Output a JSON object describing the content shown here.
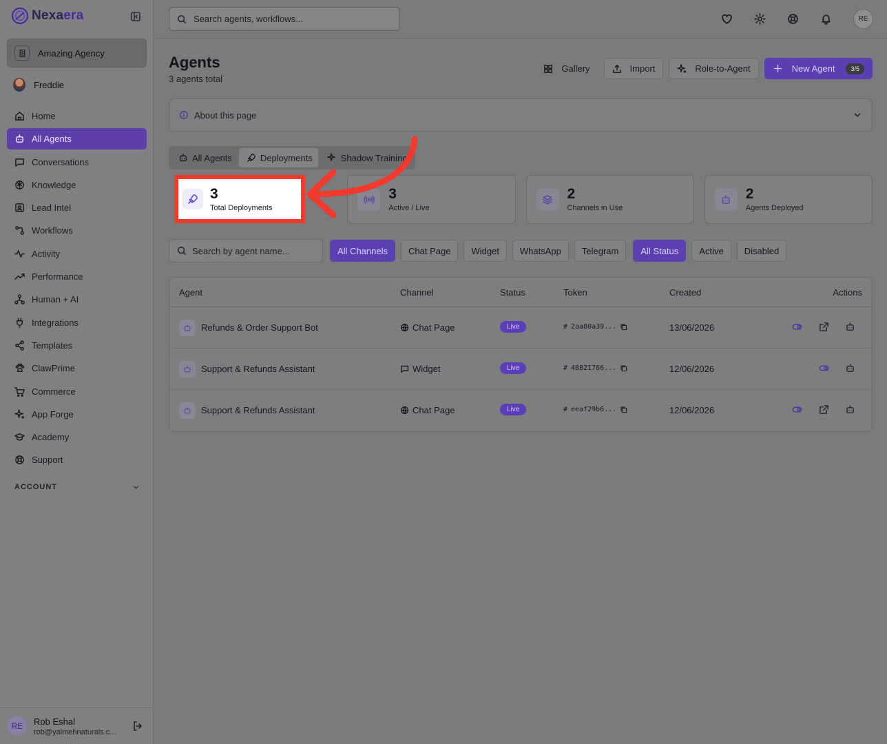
{
  "brand": {
    "name_a": "Nexa",
    "name_b": "era"
  },
  "sidebar": {
    "agency": "Amazing Agency",
    "user": "Freddie",
    "nav": [
      {
        "label": "Home",
        "icon": "home-icon"
      },
      {
        "label": "All Agents",
        "icon": "bot-icon",
        "active": true
      },
      {
        "label": "Conversations",
        "icon": "message-icon"
      },
      {
        "label": "Knowledge",
        "icon": "brain-icon"
      },
      {
        "label": "Lead Intel",
        "icon": "contact-icon"
      },
      {
        "label": "Workflows",
        "icon": "workflow-icon"
      },
      {
        "label": "Activity",
        "icon": "activity-icon"
      },
      {
        "label": "Performance",
        "icon": "trend-icon"
      },
      {
        "label": "Human + AI",
        "icon": "network-icon"
      },
      {
        "label": "Integrations",
        "icon": "plug-icon"
      },
      {
        "label": "Templates",
        "icon": "share-icon"
      },
      {
        "label": "ClawPrime",
        "icon": "paw-icon"
      },
      {
        "label": "Commerce",
        "icon": "cart-icon"
      },
      {
        "label": "App Forge",
        "icon": "sparkle-icon"
      },
      {
        "label": "Academy",
        "icon": "graduation-icon"
      },
      {
        "label": "Support",
        "icon": "lifebuoy-icon"
      }
    ],
    "account_label": "ACCOUNT",
    "footer": {
      "initials": "RE",
      "name": "Rob Eshal",
      "email": "rob@yalmehnaturals.c..."
    }
  },
  "topbar": {
    "search_placeholder": "Search agents, workflows...",
    "avatar": "RE"
  },
  "page": {
    "title": "Agents",
    "subtitle": "3 agents total"
  },
  "actions": {
    "gallery": "Gallery",
    "import": "Import",
    "role": "Role-to-Agent",
    "new_agent": "New Agent",
    "count": "3/5"
  },
  "about": "About this page",
  "tabs": [
    "All Agents",
    "Deployments",
    "Shadow Training"
  ],
  "stats": [
    {
      "value": "3",
      "label": "Total Deployments"
    },
    {
      "value": "3",
      "label": "Active / Live"
    },
    {
      "value": "2",
      "label": "Channels in Use"
    },
    {
      "value": "2",
      "label": "Agents Deployed"
    }
  ],
  "filters": {
    "search_placeholder": "Search by agent name...",
    "channels": [
      "All Channels",
      "Chat Page",
      "Widget",
      "WhatsApp",
      "Telegram"
    ],
    "statuses": [
      "All Status",
      "Active",
      "Disabled"
    ]
  },
  "table": {
    "headers": [
      "Agent",
      "Channel",
      "Status",
      "Token",
      "Created",
      "Actions"
    ],
    "rows": [
      {
        "agent": "Refunds & Order Support Bot",
        "channel": "Chat Page",
        "status": "Live",
        "token": "2aa80a39...",
        "created": "13/06/2026"
      },
      {
        "agent": "Support & Refunds Assistant",
        "channel": "Widget",
        "status": "Live",
        "token": "48821766...",
        "created": "12/06/2026"
      },
      {
        "agent": "Support & Refunds Assistant",
        "channel": "Chat Page",
        "status": "Live",
        "token": "eeaf29b6...",
        "created": "12/06/2026"
      }
    ]
  },
  "colors": {
    "accent": "#5b40b2",
    "highlight": "#f03a2e"
  }
}
